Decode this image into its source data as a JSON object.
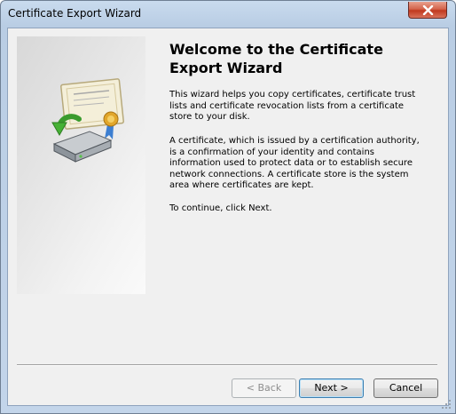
{
  "window": {
    "title": "Certificate Export Wizard"
  },
  "title_bar": {
    "close_icon": "close-icon"
  },
  "content": {
    "heading": "Welcome to the Certificate Export Wizard",
    "paragraphs": [
      "This wizard helps you copy certificates, certificate trust lists and certificate revocation lists from a certificate store to your disk.",
      "A certificate, which is issued by a certification authority, is a confirmation of your identity and contains information used to protect data or to establish secure network connections. A certificate store is the system area where certificates are kept.",
      "To continue, click Next."
    ]
  },
  "buttons": {
    "back": {
      "label": "< Back",
      "enabled": false
    },
    "next": {
      "label": "Next >",
      "enabled": true,
      "default": true
    },
    "cancel": {
      "label": "Cancel",
      "enabled": true
    }
  },
  "icons": {
    "wizard_graphic": "certificate-export-icon"
  },
  "colors": {
    "frame": "#b9cde4",
    "client_background": "#f0f0f0",
    "close_button": "#c0391f",
    "default_button_border": "#3c7fb1"
  }
}
